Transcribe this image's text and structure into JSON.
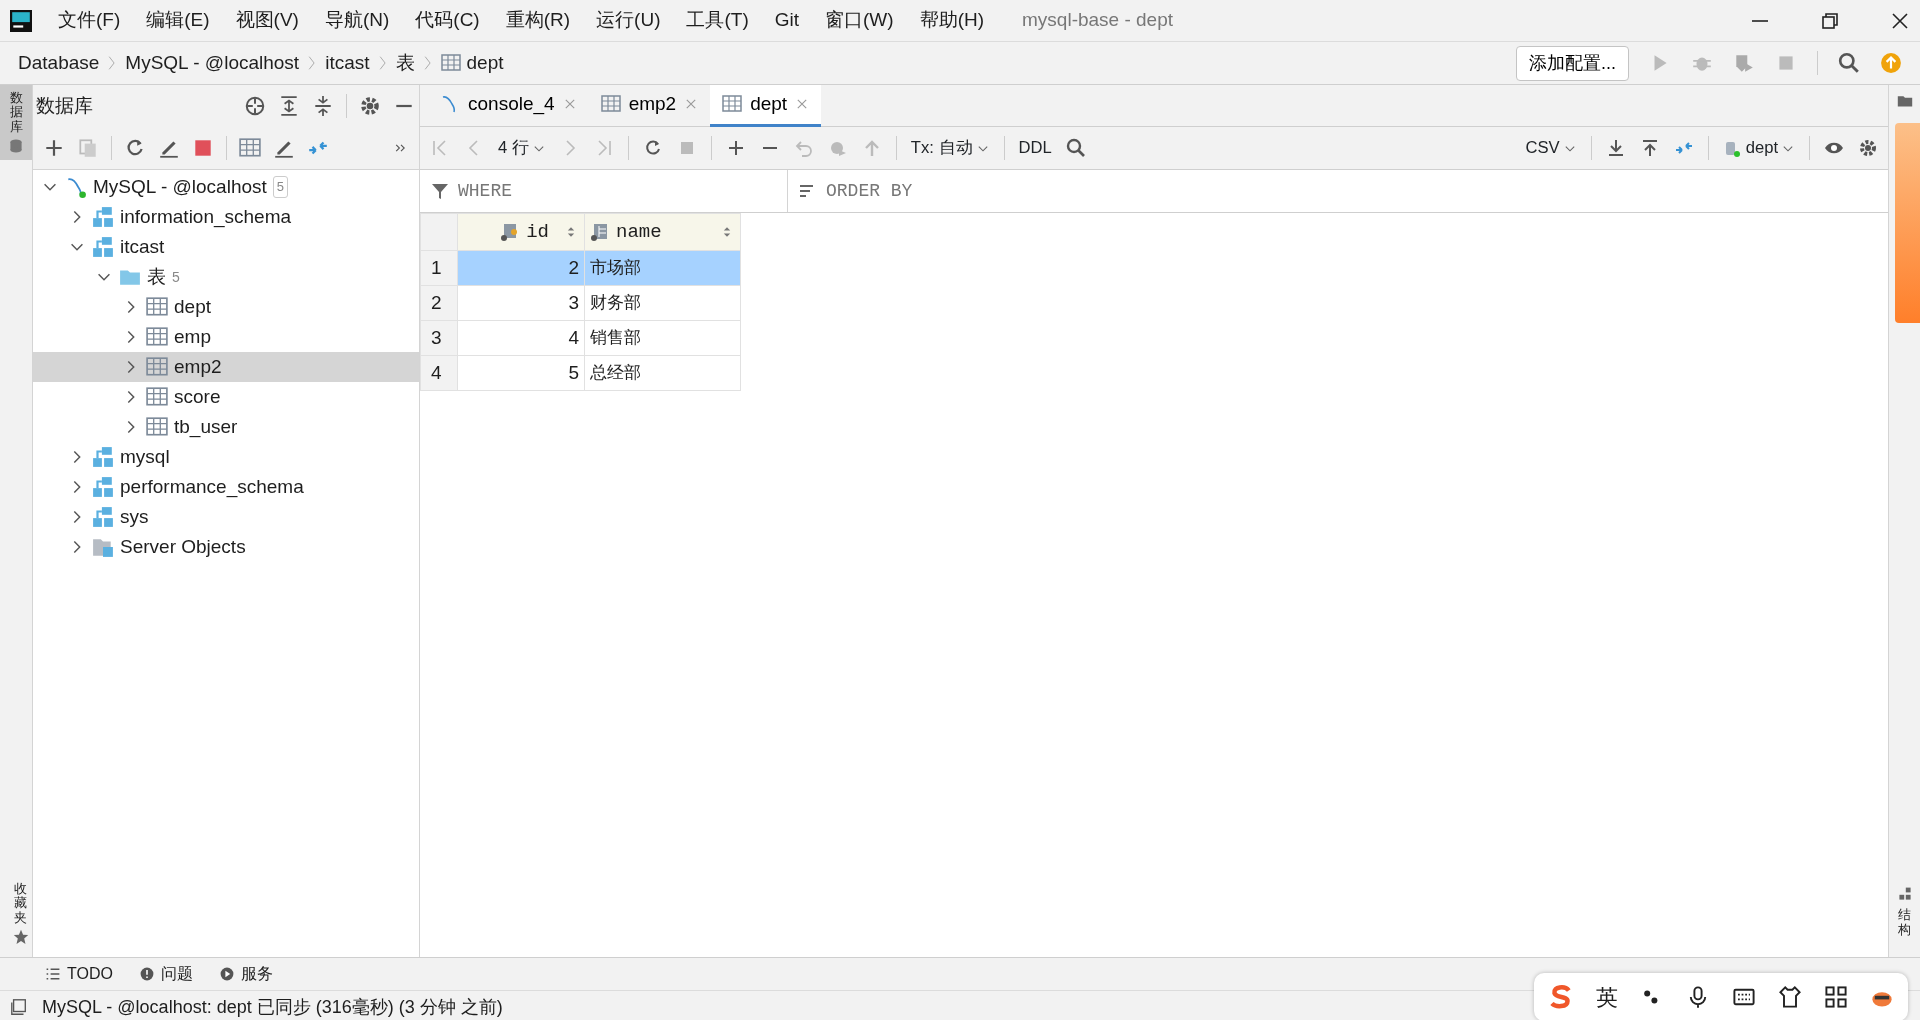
{
  "window": {
    "title": "mysql-base - dept"
  },
  "menu": [
    "文件(F)",
    "编辑(E)",
    "视图(V)",
    "导航(N)",
    "代码(C)",
    "重构(R)",
    "运行(U)",
    "工具(T)",
    "Git",
    "窗口(W)",
    "帮助(H)"
  ],
  "breadcrumb": [
    {
      "label": "Database",
      "kind": "text"
    },
    {
      "label": "MySQL - @localhost",
      "kind": "text"
    },
    {
      "label": "itcast",
      "kind": "text"
    },
    {
      "label": "表",
      "kind": "text"
    },
    {
      "label": "dept",
      "kind": "table"
    }
  ],
  "run_config": {
    "label": "添加配置..."
  },
  "left_strip": {
    "top": "数据库",
    "bottom": "收藏夹"
  },
  "db_panel": {
    "title": "数据库",
    "tree": [
      {
        "label": "MySQL - @localhost",
        "count": "5",
        "kind": "server",
        "expanded": true,
        "selected": false,
        "children": [
          {
            "label": "information_schema",
            "kind": "schema",
            "expanded": false,
            "selected": false
          },
          {
            "label": "itcast",
            "kind": "schema",
            "expanded": true,
            "selected": false,
            "children": [
              {
                "label": "表",
                "count": "5",
                "kind": "folder",
                "expanded": true,
                "selected": false,
                "children": [
                  {
                    "label": "dept",
                    "kind": "table",
                    "expanded": false,
                    "selected": false
                  },
                  {
                    "label": "emp",
                    "kind": "table",
                    "expanded": false,
                    "selected": false
                  },
                  {
                    "label": "emp2",
                    "kind": "table",
                    "expanded": false,
                    "selected": true
                  },
                  {
                    "label": "score",
                    "kind": "table",
                    "expanded": false,
                    "selected": false
                  },
                  {
                    "label": "tb_user",
                    "kind": "table",
                    "expanded": false,
                    "selected": false
                  }
                ]
              }
            ]
          },
          {
            "label": "mysql",
            "kind": "schema",
            "expanded": false,
            "selected": false
          },
          {
            "label": "performance_schema",
            "kind": "schema",
            "expanded": false,
            "selected": false
          },
          {
            "label": "sys",
            "kind": "schema",
            "expanded": false,
            "selected": false
          },
          {
            "label": "Server Objects",
            "kind": "objects",
            "expanded": false,
            "selected": false
          }
        ]
      }
    ]
  },
  "editor_tabs": [
    {
      "label": "console_4",
      "kind": "console",
      "selected": false
    },
    {
      "label": "emp2",
      "kind": "table",
      "selected": false
    },
    {
      "label": "dept",
      "kind": "table",
      "selected": true
    }
  ],
  "data_toolbar": {
    "rows": "4 行",
    "tx": "Tx: 自动",
    "ddl": "DDL",
    "export": "CSV",
    "schema": "dept"
  },
  "filter": {
    "where": "WHERE",
    "order_by": "ORDER BY"
  },
  "table": {
    "columns": [
      {
        "name": "id",
        "kind": "key"
      },
      {
        "name": "name",
        "kind": "column"
      }
    ],
    "rows": [
      {
        "num": "1",
        "cells": [
          "2",
          "市场部"
        ],
        "selected": true
      },
      {
        "num": "2",
        "cells": [
          "3",
          "财务部"
        ],
        "selected": false
      },
      {
        "num": "3",
        "cells": [
          "4",
          "销售部"
        ],
        "selected": false
      },
      {
        "num": "4",
        "cells": [
          "5",
          "总经部"
        ],
        "selected": false
      }
    ]
  },
  "right_strip": {
    "bottom": "结构"
  },
  "tool_tabs": [
    "TODO",
    "问题",
    "服务"
  ],
  "status_bar": "MySQL - @localhost: dept 已同步 (316毫秒) (3 分钟 之前)",
  "ime_toolbar": {
    "lang": "英"
  }
}
